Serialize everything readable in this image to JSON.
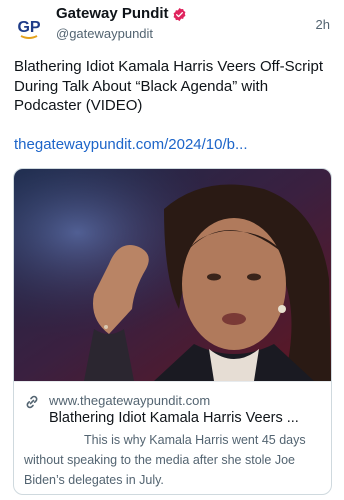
{
  "post": {
    "author_name": "Gateway Pundit",
    "author_handle": "@gatewaypundit",
    "avatar_text": "GP",
    "time": "2h",
    "text": "Blathering Idiot Kamala Harris Veers Off-Script During Talk About “Black Agenda” with Podcaster (VIDEO)",
    "link_text": "thegatewaypundit.com/2024/10/b..."
  },
  "card": {
    "domain": "www.thegatewaypundit.com",
    "title": "Blathering Idiot Kamala Harris Veers ...",
    "description": "This is why Kamala Harris went 45 days without speaking to the media after she stole Joe Biden’s delegates in July."
  },
  "colors": {
    "link": "#1d65c9",
    "verified_badge": "#e0245e",
    "avatar_letters": "#1f3c88",
    "secondary_text": "#536471"
  },
  "icons": [
    "verified-badge-icon",
    "link-icon"
  ]
}
